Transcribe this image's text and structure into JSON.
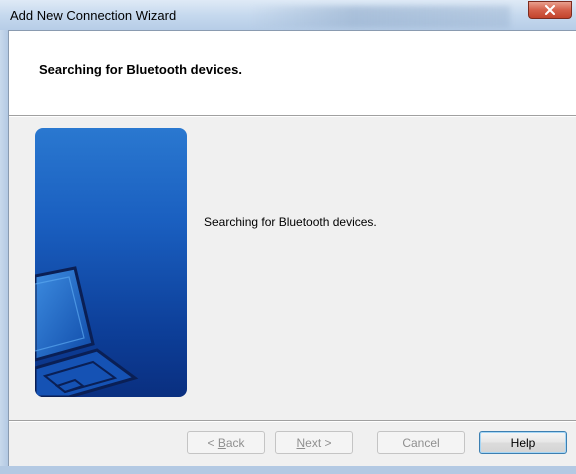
{
  "window": {
    "title": "Add New Connection Wizard",
    "close_icon": "close-icon"
  },
  "header": {
    "title": "Searching for Bluetooth devices."
  },
  "main": {
    "message": "Searching for Bluetooth devices.",
    "image": "laptop-illustration"
  },
  "buttons": {
    "back": {
      "prefix": "< ",
      "mnemonic": "B",
      "rest": "ack"
    },
    "next": {
      "mnemonic": "N",
      "rest": "ext >"
    },
    "cancel": "Cancel",
    "help": "Help"
  },
  "colors": {
    "accent": "#1a5fc0",
    "close": "#c2432b"
  }
}
